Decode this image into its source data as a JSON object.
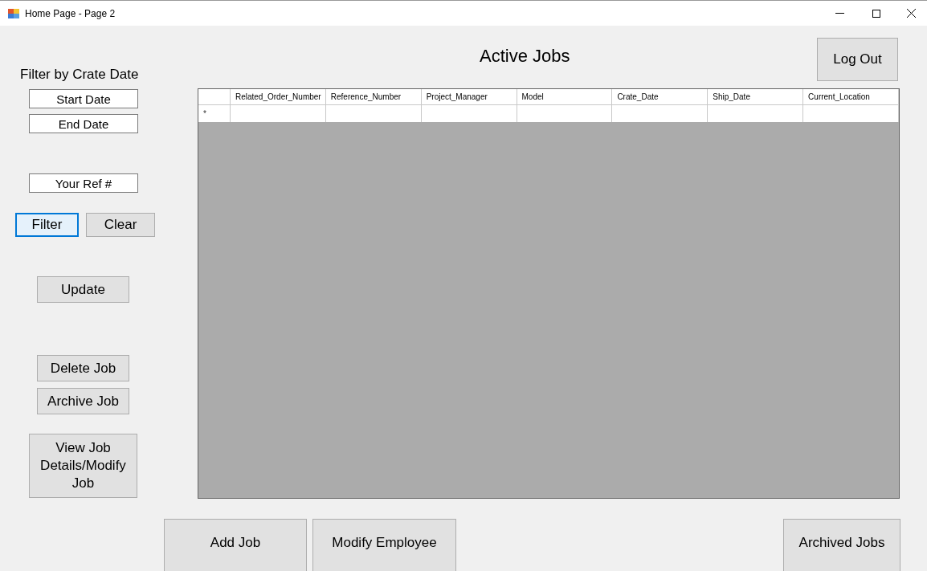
{
  "window": {
    "title": "Home Page - Page 2"
  },
  "filter_label": "Filter by Crate Date",
  "fields": [
    {
      "value": "Start Date"
    },
    {
      "value": "End Date"
    },
    {
      "value": "Your Ref #"
    }
  ],
  "filter_buttons": [
    {
      "label": "Filter",
      "focused": true
    },
    {
      "label": "Clear",
      "focused": false
    }
  ],
  "side_buttons": [
    {
      "label": "Update"
    },
    {
      "label": "Delete Job"
    },
    {
      "label": "Archive Job"
    },
    {
      "label": "View Job Details/Modify Job"
    }
  ],
  "heading": "Active Jobs",
  "logout_button": "Log Out",
  "table": {
    "columns": [
      "Related_Order_Number",
      "Reference_Number",
      "Project_Manager",
      "Model",
      "Crate_Date",
      "Ship_Date",
      "Current_Location"
    ],
    "new_row_marker": "*"
  },
  "bottom_buttons": [
    "Add Job",
    "Modify Employee",
    "Archived Jobs"
  ]
}
